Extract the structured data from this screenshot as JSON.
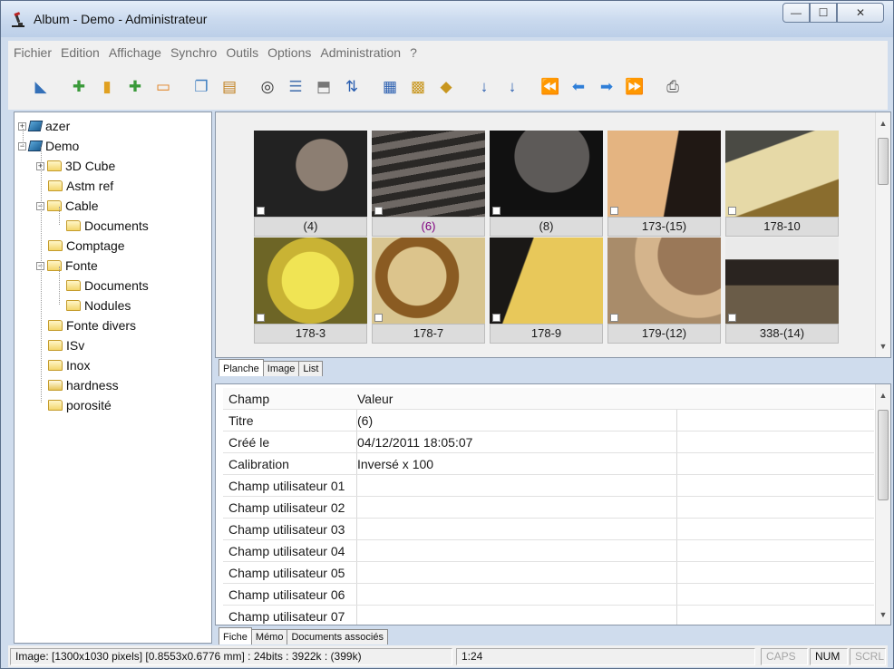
{
  "window": {
    "title": "Album - Demo - Administrateur"
  },
  "menu": [
    "Fichier",
    "Edition",
    "Affichage",
    "Synchro",
    "Outils",
    "Options",
    "Administration",
    "?"
  ],
  "toolbar_icons": [
    "open-album-icon",
    "add-folder-icon",
    "folder-icon",
    "add-page-icon",
    "remove-page-icon",
    "copy-icon",
    "paste-icon",
    "find-icon",
    "properties-icon",
    "export-icon",
    "sort-az-icon",
    "number-icon",
    "stack-icon",
    "tag-icon",
    "sort-asc-icon",
    "sort-desc-icon",
    "first-icon",
    "previous-icon",
    "next-icon",
    "last-icon",
    "print-icon"
  ],
  "tree": {
    "nodes": [
      {
        "label": "azer",
        "type": "album",
        "expander": "+"
      },
      {
        "label": "Demo",
        "type": "album",
        "expander": "-"
      },
      {
        "label": "3D Cube",
        "type": "folder",
        "expander": "+"
      },
      {
        "label": "Astm ref",
        "type": "folder"
      },
      {
        "label": "Cable",
        "type": "folder",
        "expander": "-"
      },
      {
        "label": "Documents",
        "type": "folder"
      },
      {
        "label": "Comptage",
        "type": "folder"
      },
      {
        "label": "Fonte",
        "type": "folder",
        "expander": "-"
      },
      {
        "label": "Documents",
        "type": "folder"
      },
      {
        "label": "Nodules",
        "type": "folder"
      },
      {
        "label": "Fonte divers",
        "type": "folder"
      },
      {
        "label": "ISv",
        "type": "folder"
      },
      {
        "label": "Inox",
        "type": "folder"
      },
      {
        "label": "hardness",
        "type": "folder-open"
      },
      {
        "label": "porosité",
        "type": "folder"
      }
    ]
  },
  "thumbnails": [
    {
      "caption": "(4)",
      "selected": false
    },
    {
      "caption": "(6)",
      "selected": true
    },
    {
      "caption": "(8)",
      "selected": false
    },
    {
      "caption": "173-(15)",
      "selected": false
    },
    {
      "caption": "178-10",
      "selected": false
    },
    {
      "caption": "178-3",
      "selected": false
    },
    {
      "caption": "178-7",
      "selected": false
    },
    {
      "caption": "178-9",
      "selected": false
    },
    {
      "caption": "179-(12)",
      "selected": false
    },
    {
      "caption": "338-(14)",
      "selected": false
    }
  ],
  "view_tabs": [
    "Planche",
    "Image",
    "List"
  ],
  "properties": {
    "headers": [
      "Champ",
      "Valeur"
    ],
    "rows": [
      [
        "Titre",
        "(6)"
      ],
      [
        "Créé le",
        "04/12/2011 18:05:07"
      ],
      [
        "Calibration",
        "Inversé x 100"
      ],
      [
        "Champ utilisateur 01",
        ""
      ],
      [
        "Champ utilisateur 02",
        ""
      ],
      [
        "Champ utilisateur 03",
        ""
      ],
      [
        "Champ utilisateur 04",
        ""
      ],
      [
        "Champ utilisateur 05",
        ""
      ],
      [
        "Champ utilisateur 06",
        ""
      ],
      [
        "Champ utilisateur 07",
        ""
      ]
    ]
  },
  "detail_tabs": [
    "Fiche",
    "Mémo",
    "Documents associés"
  ],
  "status": {
    "info": "Image: [1300x1030 pixels] [0.8553x0.6776 mm] : 24bits : 3922k : (399k)",
    "zoom": "1:24",
    "caps": "CAPS",
    "num": "NUM",
    "scrl": "SCRL"
  },
  "colors": {
    "selected_caption": "#800080",
    "title_bar": "#c9d9ee"
  }
}
